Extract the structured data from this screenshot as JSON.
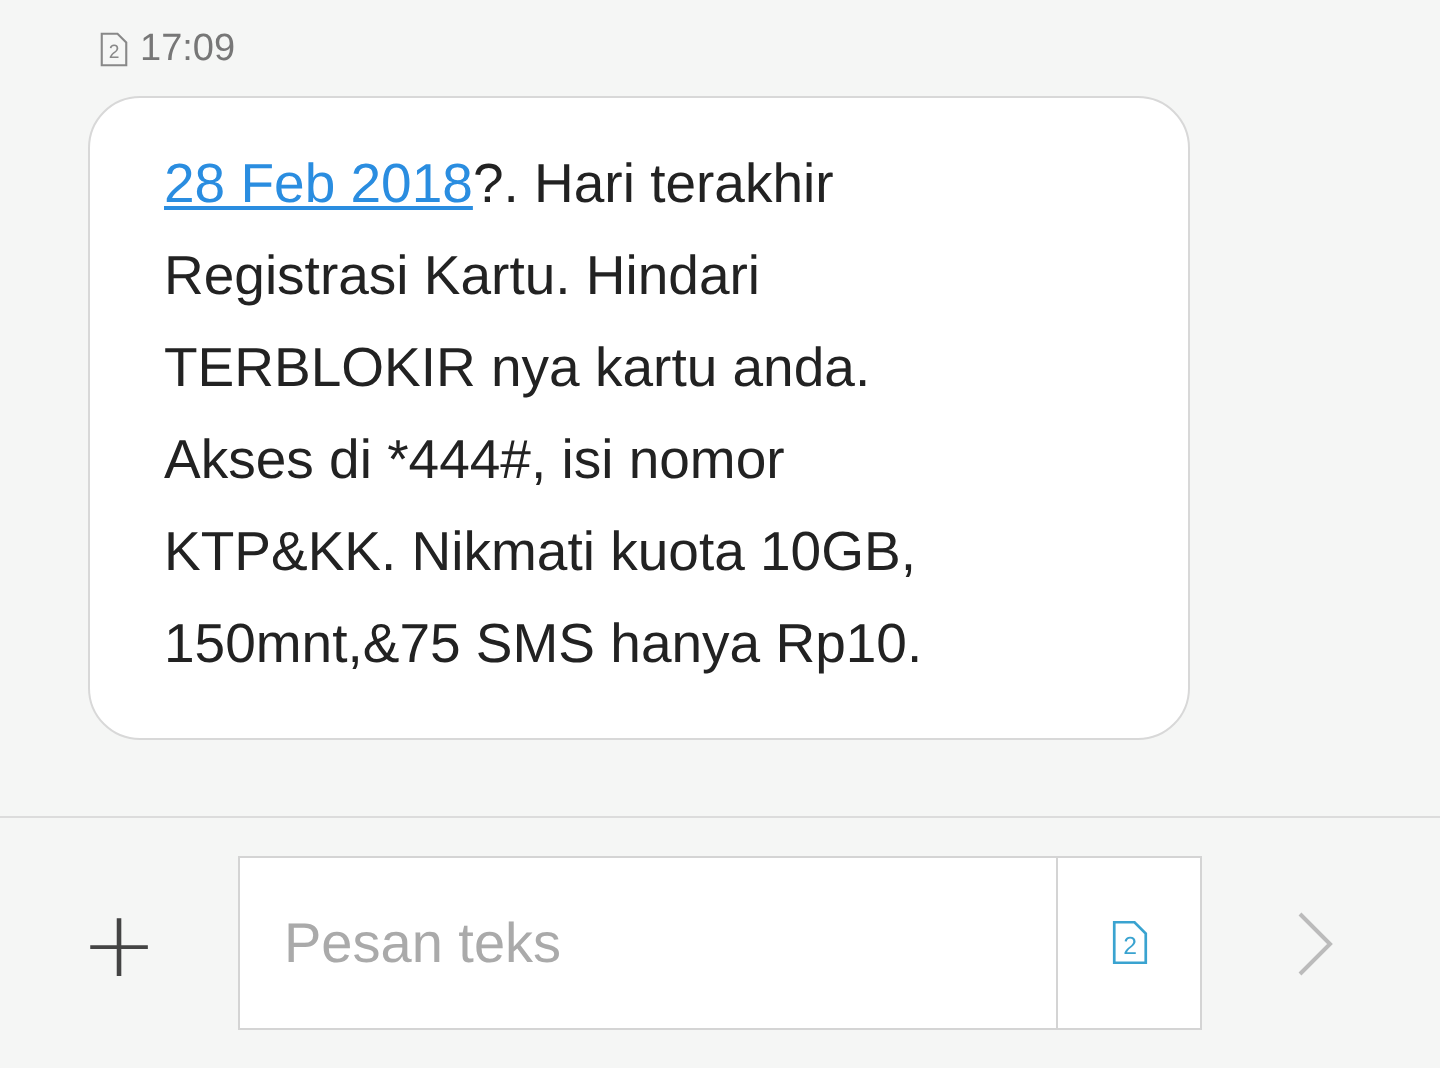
{
  "message": {
    "sim": "2",
    "time": "17:09",
    "link": "28 Feb 2018",
    "text": "?. Hari terakhir\nRegistrasi Kartu. Hindari\nTERBLOKIR nya kartu anda.\nAkses di *444#, isi nomor\nKTP&KK. Nikmati kuota 10GB,\n150mnt,&75 SMS hanya Rp10."
  },
  "composer": {
    "placeholder": "Pesan teks",
    "sim": "2",
    "add": "+"
  }
}
